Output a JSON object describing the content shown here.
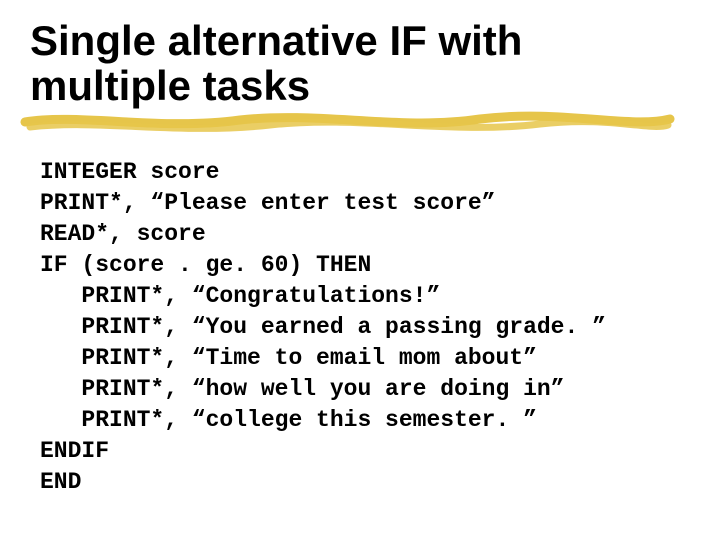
{
  "title_line1": "Single alternative IF with",
  "title_line2": "multiple tasks",
  "code_lines": {
    "l0": "INTEGER score",
    "l1": "PRINT*, “Please enter test score”",
    "l2": "READ*, score",
    "l3": "IF (score . ge. 60) THEN",
    "l4": "   PRINT*, “Congratulations!”",
    "l5": "   PRINT*, “You earned a passing grade. ”",
    "l6": "   PRINT*, “Time to email mom about”",
    "l7": "   PRINT*, “how well you are doing in”",
    "l8": "   PRINT*, “college this semester. ”",
    "l9": "ENDIF",
    "l10": "END"
  }
}
